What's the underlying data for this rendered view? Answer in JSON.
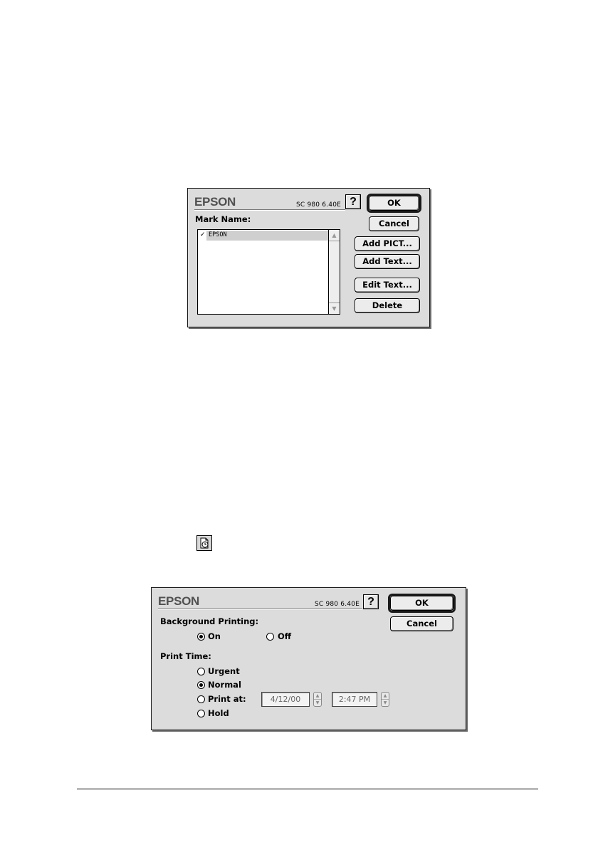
{
  "watermark_dialog": {
    "logo": "EPSON",
    "version": "SC 980 6.40E",
    "help_label": "?",
    "ok_label": "OK",
    "cancel_label": "Cancel",
    "mark_name_label": "Mark Name:",
    "list_items": [
      {
        "label": "EPSON",
        "checked": true,
        "check_glyph": "✓"
      }
    ],
    "scroll_up_glyph": "▲",
    "scroll_down_glyph": "▼",
    "add_pict_label": "Add PICT...",
    "add_text_label": "Add Text...",
    "edit_text_label": "Edit Text...",
    "delete_label": "Delete"
  },
  "page_icon": {
    "icon": "background-printing-clock-icon"
  },
  "background_dialog": {
    "logo": "EPSON",
    "version": "SC 980 6.40E",
    "help_label": "?",
    "ok_label": "OK",
    "cancel_label": "Cancel",
    "background_printing_label": "Background Printing:",
    "on_label": "On",
    "off_label": "Off",
    "background_printing_selected": "On",
    "print_time_label": "Print Time:",
    "urgent_label": "Urgent",
    "normal_label": "Normal",
    "print_at_label": "Print at:",
    "hold_label": "Hold",
    "print_time_selected": "Normal",
    "date_value": "4/12/00",
    "time_value": "2:47 PM",
    "stepper_up_glyph": "▲",
    "stepper_down_glyph": "▼"
  }
}
